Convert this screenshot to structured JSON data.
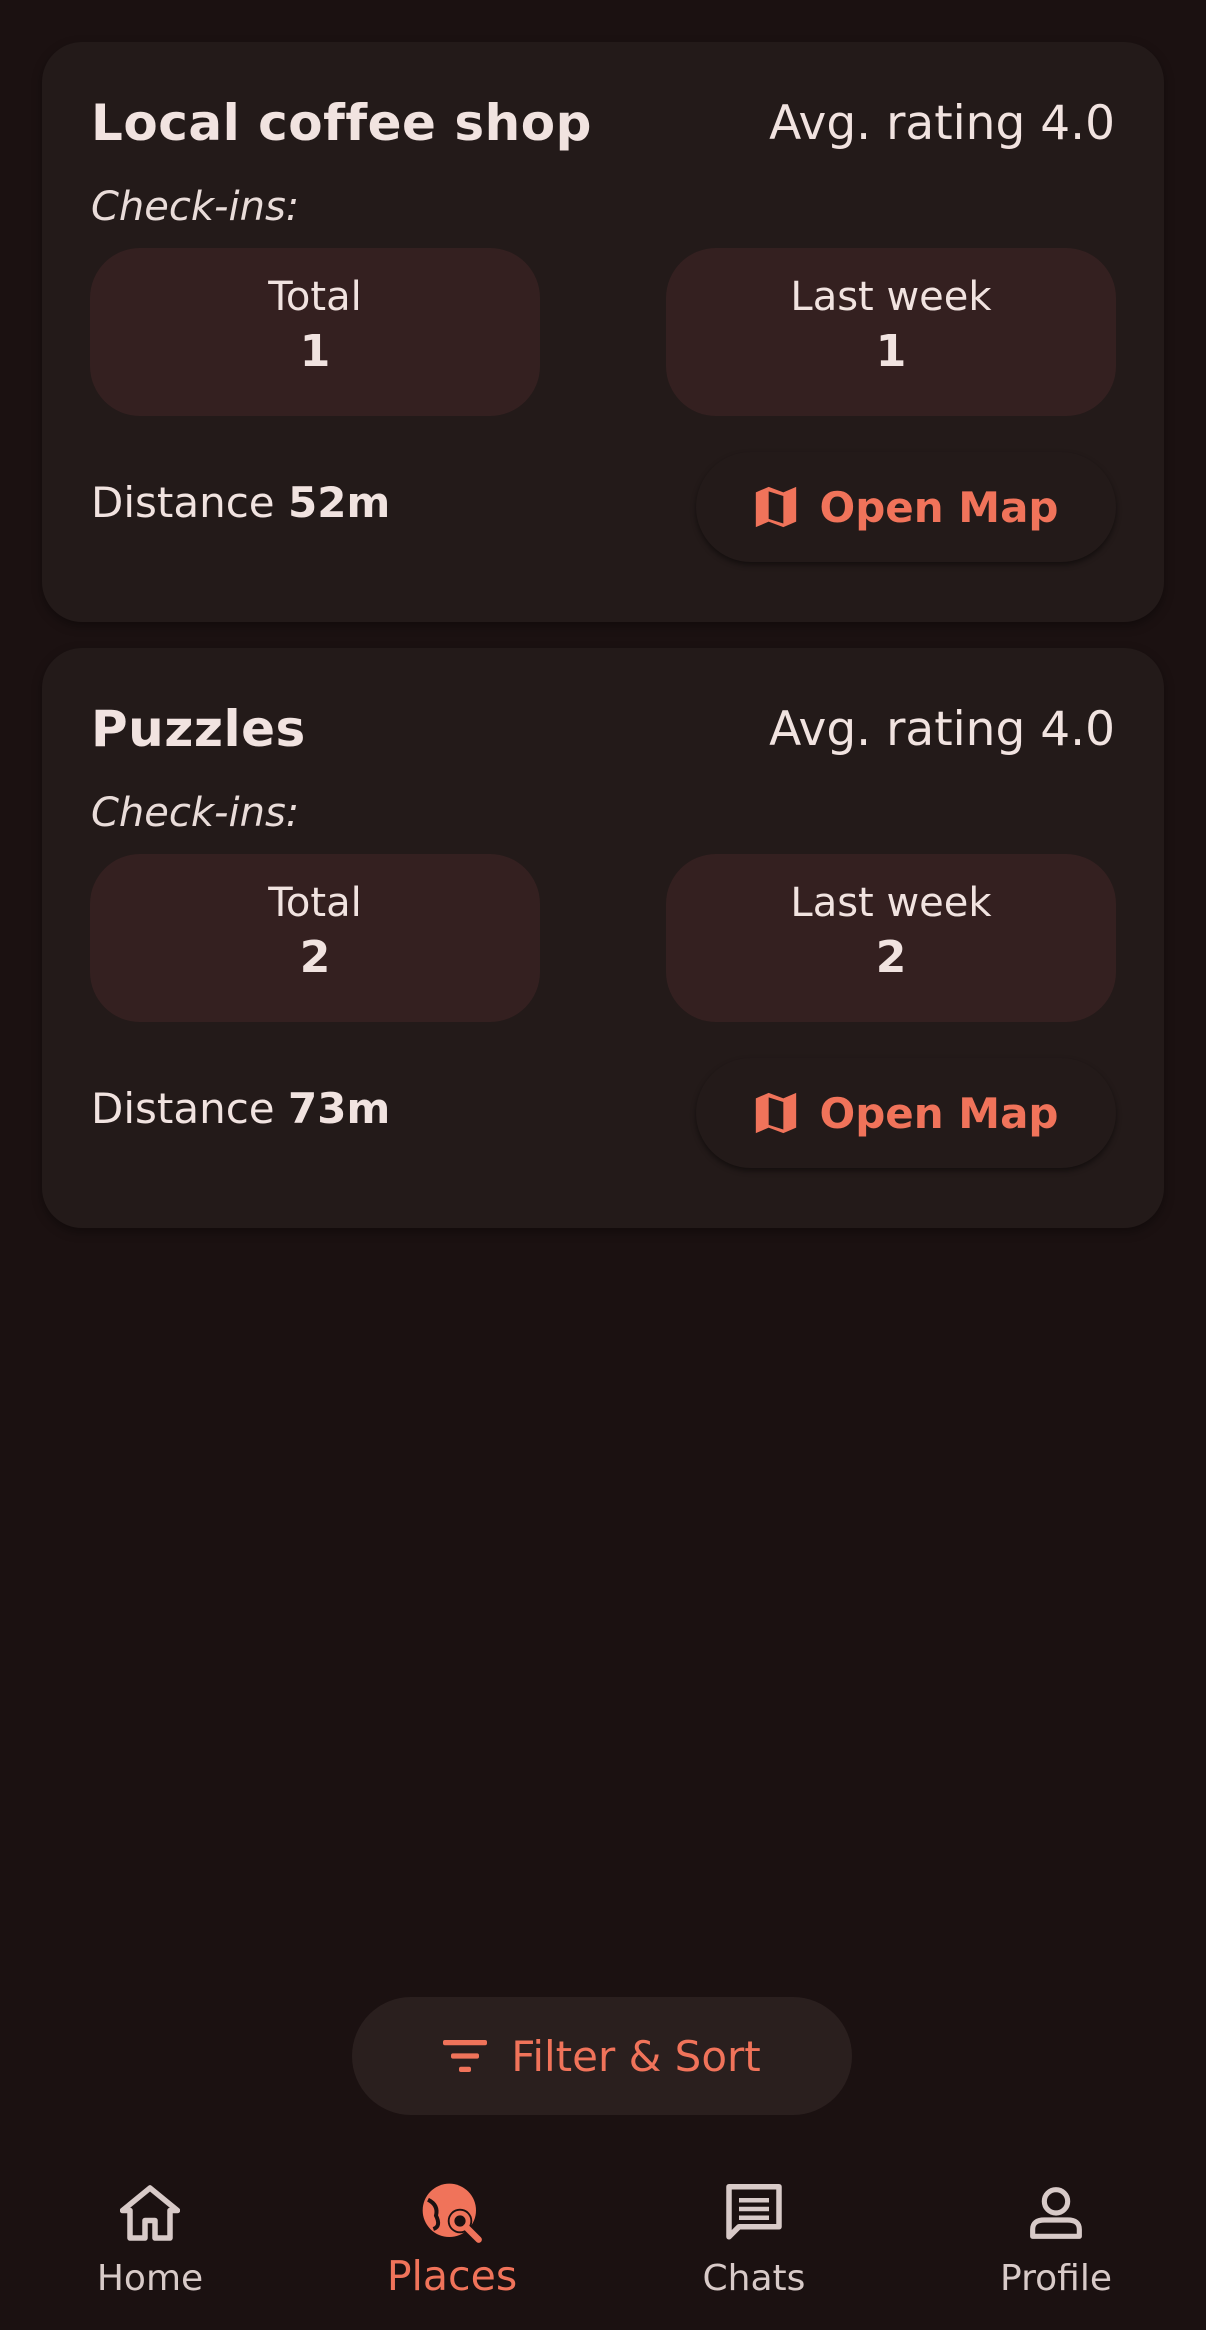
{
  "places": [
    {
      "name": "Local coffee shop",
      "rating": "Avg. rating 4.0",
      "checkins_label": "Check-ins:",
      "total_label": "Total",
      "total_value": "1",
      "week_label": "Last week",
      "week_value": "1",
      "distance_label": "Distance",
      "distance_value": "52m",
      "map_button": "Open Map"
    },
    {
      "name": "Puzzles",
      "rating": "Avg. rating 4.0",
      "checkins_label": "Check-ins:",
      "total_label": "Total",
      "total_value": "2",
      "week_label": "Last week",
      "week_value": "2",
      "distance_label": "Distance",
      "distance_value": "73m",
      "map_button": "Open Map"
    }
  ],
  "fab": {
    "label": "Filter & Sort",
    "icon": "filter-icon"
  },
  "nav": {
    "items": [
      {
        "label": "Home",
        "icon": "home-icon"
      },
      {
        "label": "Places",
        "icon": "places-search-icon",
        "active": true
      },
      {
        "label": "Chats",
        "icon": "chat-icon"
      },
      {
        "label": "Profile",
        "icon": "profile-icon"
      }
    ]
  },
  "colors": {
    "background": "#1b1111",
    "card": "#231a19",
    "stat_box": "#342020",
    "accent": "#f0735a",
    "text": "#f1e3e0"
  }
}
